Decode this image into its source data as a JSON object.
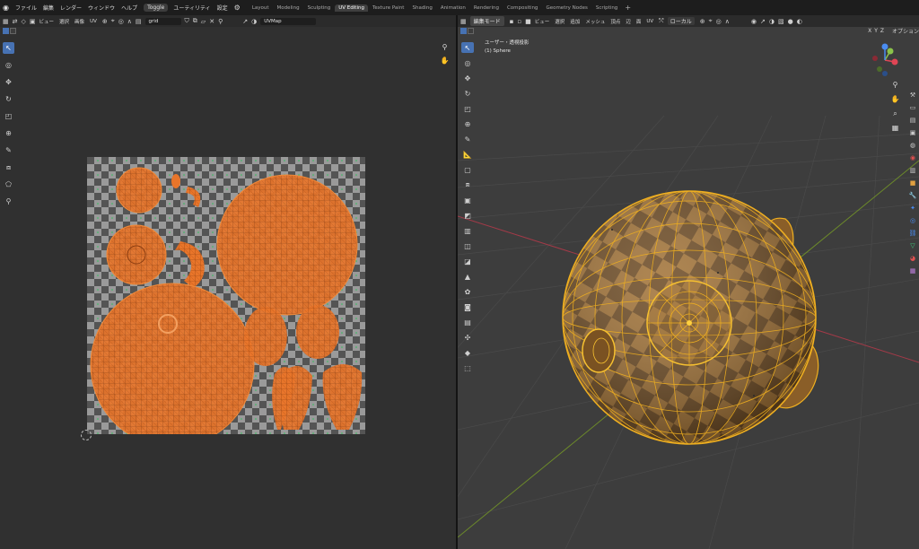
{
  "topbar": {
    "menus": [
      "ファイル",
      "編集",
      "レンダー",
      "ウィンドウ",
      "ヘルプ"
    ],
    "toggle_label": "Toggle",
    "menus_after": [
      "ユーティリティ",
      "設定"
    ],
    "workspaces": [
      {
        "label": "Layout",
        "active": false
      },
      {
        "label": "Modeling",
        "active": false
      },
      {
        "label": "Sculpting",
        "active": false
      },
      {
        "label": "UV Editing",
        "active": true
      },
      {
        "label": "Texture Paint",
        "active": false
      },
      {
        "label": "Shading",
        "active": false
      },
      {
        "label": "Animation",
        "active": false
      },
      {
        "label": "Rendering",
        "active": false
      },
      {
        "label": "Compositing",
        "active": false
      },
      {
        "label": "Geometry Nodes",
        "active": false
      },
      {
        "label": "Scripting",
        "active": false
      }
    ],
    "add_workspace": "+"
  },
  "uv_editor": {
    "menus": [
      "ビュー",
      "選択",
      "画像",
      "UV"
    ],
    "image_name": "grid",
    "uv_map": "UVMap"
  },
  "viewport": {
    "mode": "編集モード",
    "menus": [
      "ビュー",
      "選択",
      "追加",
      "メッシュ",
      "頂点",
      "辺",
      "面",
      "UV"
    ],
    "orientation": "ローカル",
    "axis_x": "X",
    "axis_y": "Y",
    "axis_z": "Z",
    "options": "オプション",
    "view_name": "ユーザー・透視投影",
    "object_name": "(1) Sphere"
  },
  "colors": {
    "uv_orange": "#e8752a",
    "checker_light": "#9a9a9a",
    "checker_dark": "#545454",
    "wire_yellow": "#f0b020",
    "accent_blue": "#4772b3"
  }
}
